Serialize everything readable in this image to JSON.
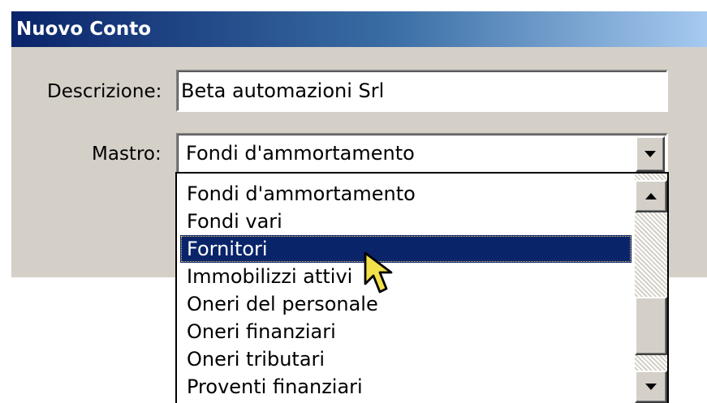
{
  "window": {
    "title": "Nuovo Conto"
  },
  "form": {
    "descrizione_label": "Descrizione:",
    "descrizione_value": "Beta automazioni Srl",
    "mastro_label": "Mastro:",
    "mastro_value": "Fondi d'ammortamento"
  },
  "dropdown": {
    "items": [
      {
        "label": "Fondi d'ammortamento",
        "selected": false
      },
      {
        "label": "Fondi vari",
        "selected": false
      },
      {
        "label": "Fornitori",
        "selected": true
      },
      {
        "label": "Immobilizzi attivi",
        "selected": false
      },
      {
        "label": "Oneri del personale",
        "selected": false
      },
      {
        "label": "Oneri finanziari",
        "selected": false
      },
      {
        "label": "Oneri tributari",
        "selected": false
      },
      {
        "label": "Proventi finanziari",
        "selected": false
      }
    ]
  },
  "icons": {
    "combo_arrow": "chevron-down-icon",
    "scroll_up": "arrow-up-icon",
    "scroll_down": "arrow-down-icon",
    "pointer": "mouse-pointer-icon"
  },
  "colors": {
    "title_bar_start": "#0a246a",
    "title_bar_end": "#a6caf0",
    "dialog_face": "#d4d0c8",
    "selection": "#0a246a"
  }
}
